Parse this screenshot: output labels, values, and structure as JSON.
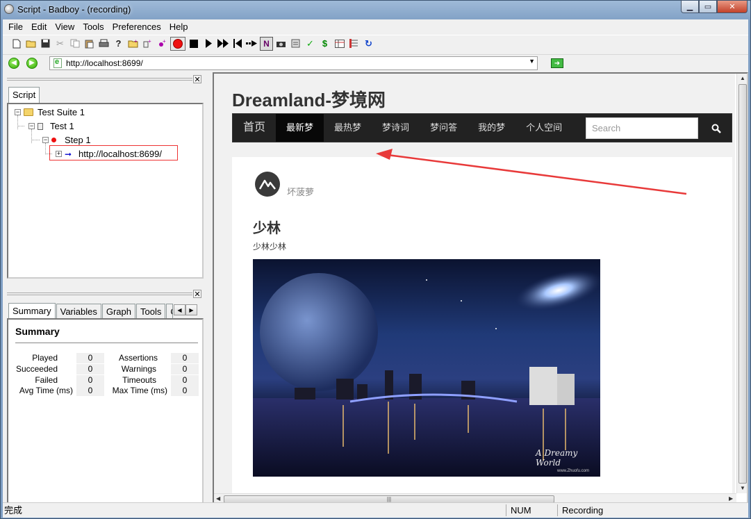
{
  "window": {
    "title": "Script - Badboy - (recording)"
  },
  "menu": [
    "File",
    "Edit",
    "View",
    "Tools",
    "Preferences",
    "Help"
  ],
  "toolbar": {
    "icons": [
      "new-file-icon",
      "open-folder-icon",
      "save-icon",
      "cut-icon",
      "copy-icon",
      "paste-icon",
      "print-icon",
      "help-icon",
      "add-folder-icon",
      "add-item-icon",
      "add-step-icon",
      "record-icon",
      "stop-icon",
      "play-icon",
      "fast-forward-icon",
      "rewind-icon",
      "navigate-icon",
      "n-mode-icon",
      "camera-icon",
      "form-icon",
      "check-icon",
      "dollar-icon",
      "table-icon",
      "list-icon",
      "refresh-icon"
    ],
    "check_glyph": "✓",
    "dollar_glyph": "$",
    "n_label": "N"
  },
  "address": {
    "url": "http://localhost:8699/"
  },
  "script_panel": {
    "tab": "Script",
    "tree": {
      "suite": "Test Suite 1",
      "test": "Test 1",
      "step": "Step 1",
      "request": "http://localhost:8699/"
    }
  },
  "summary_panel": {
    "tabs": [
      "Summary",
      "Variables",
      "Graph",
      "Tools",
      "C"
    ],
    "title": "Summary",
    "left_stats": [
      {
        "label": "Played",
        "value": "0"
      },
      {
        "label": "Succeeded",
        "value": "0"
      },
      {
        "label": "Failed",
        "value": "0"
      },
      {
        "label": "Avg Time (ms)",
        "value": "0"
      }
    ],
    "right_stats": [
      {
        "label": "Assertions",
        "value": "0"
      },
      {
        "label": "Warnings",
        "value": "0"
      },
      {
        "label": "Timeouts",
        "value": "0"
      },
      {
        "label": "Max Time (ms)",
        "value": "0"
      }
    ]
  },
  "webpage": {
    "site_title": "Dreamland-梦境网",
    "nav": [
      "首页",
      "最新梦",
      "最热梦",
      "梦诗词",
      "梦问答",
      "我的梦",
      "个人空间"
    ],
    "active_nav": "最新梦",
    "search_placeholder": "Search",
    "post": {
      "author": "坏菠萝",
      "title": "少林",
      "excerpt": "少林少林",
      "image_caption": "A Dreamy World",
      "image_credit": "www.Zhuofu.com"
    }
  },
  "status": {
    "left": "完成",
    "num": "NUM",
    "mode": "Recording"
  },
  "colors": {
    "annotation_arrow": "#e83a3a",
    "record_red": "#e11111",
    "nav_bg": "#222222"
  }
}
